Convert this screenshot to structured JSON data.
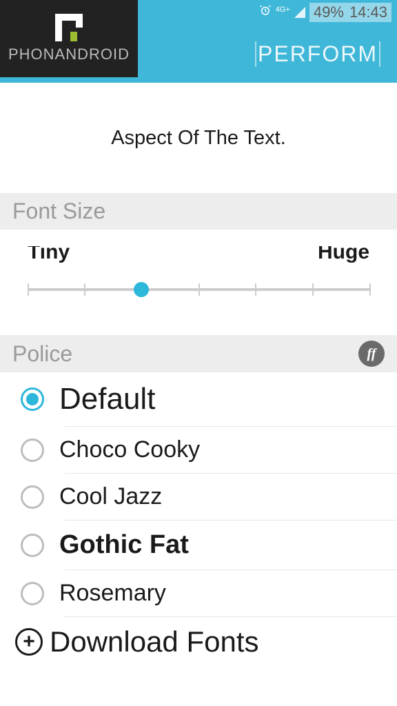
{
  "status": {
    "alarm_icon": "alarm",
    "network_label": "4G+",
    "battery_pct": "49%",
    "time": "14:43"
  },
  "header": {
    "title": "PERFORM"
  },
  "logo": {
    "text": "PHONANDROID"
  },
  "preview": {
    "text": "Aspect Of The Text."
  },
  "sections": {
    "font_size": "Font Size",
    "police": "Police"
  },
  "slider": {
    "min_label": "Tiny",
    "max_label": "Huge",
    "ticks": [
      0,
      16.6,
      33.3,
      50,
      66.6,
      83.3,
      100
    ],
    "value_pct": 33.3
  },
  "ff_badge": "ff",
  "fonts": {
    "options": [
      {
        "label": "Default",
        "selected": true,
        "cls": "big"
      },
      {
        "label": "Choco Cooky",
        "selected": false,
        "cls": ""
      },
      {
        "label": "Cool Jazz",
        "selected": false,
        "cls": ""
      },
      {
        "label": "Gothic Fat",
        "selected": false,
        "cls": "med"
      },
      {
        "label": "Rosemary",
        "selected": false,
        "cls": ""
      }
    ],
    "download": "Download Fonts"
  }
}
